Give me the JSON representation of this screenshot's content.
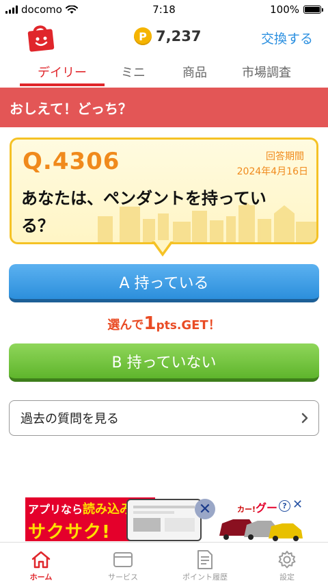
{
  "status_bar": {
    "carrier": "docomo",
    "time": "7:18",
    "battery": "100%"
  },
  "header": {
    "points": "7,237",
    "coin_symbol": "P",
    "exchange_label": "交換する"
  },
  "tabs": [
    {
      "label": "デイリー",
      "active": true
    },
    {
      "label": "ミニ",
      "active": false
    },
    {
      "label": "商品",
      "active": false
    },
    {
      "label": "市場調査",
      "active": false
    }
  ],
  "banner": {
    "title": "おしえて！どっち？"
  },
  "question": {
    "number": "Q.4306",
    "deadline_label": "回答期間",
    "deadline_date": "2024年4月16日",
    "text": "あなたは、ペンダントを持っている？"
  },
  "answers": {
    "a_label": "A 持っている",
    "b_label": "B 持っていない"
  },
  "reward": {
    "prefix": "選んで",
    "amount": "1",
    "unit": "pts.",
    "suffix": "GET！"
  },
  "history_button": {
    "label": "過去の質問を見る"
  },
  "ad": {
    "line1_a": "アプリなら",
    "line1_b": "読み込み",
    "line2": "サクサク!",
    "brand_small": "カー!",
    "brand_big": "グー",
    "info": "?",
    "close": "✕"
  },
  "tabbar": [
    {
      "label": "ホーム",
      "icon": "home-icon",
      "active": true
    },
    {
      "label": "サービス",
      "icon": "card-icon",
      "active": false
    },
    {
      "label": "ポイント履歴",
      "icon": "document-icon",
      "active": false
    },
    {
      "label": "設定",
      "icon": "gear-icon",
      "active": false
    }
  ],
  "colors": {
    "brand_red": "#e0262b",
    "banner": "#e35656",
    "answer_a": "#2c8fdc",
    "answer_b": "#5fb52c",
    "accent_orange": "#f08a1c",
    "link_blue": "#2a8fe0"
  }
}
